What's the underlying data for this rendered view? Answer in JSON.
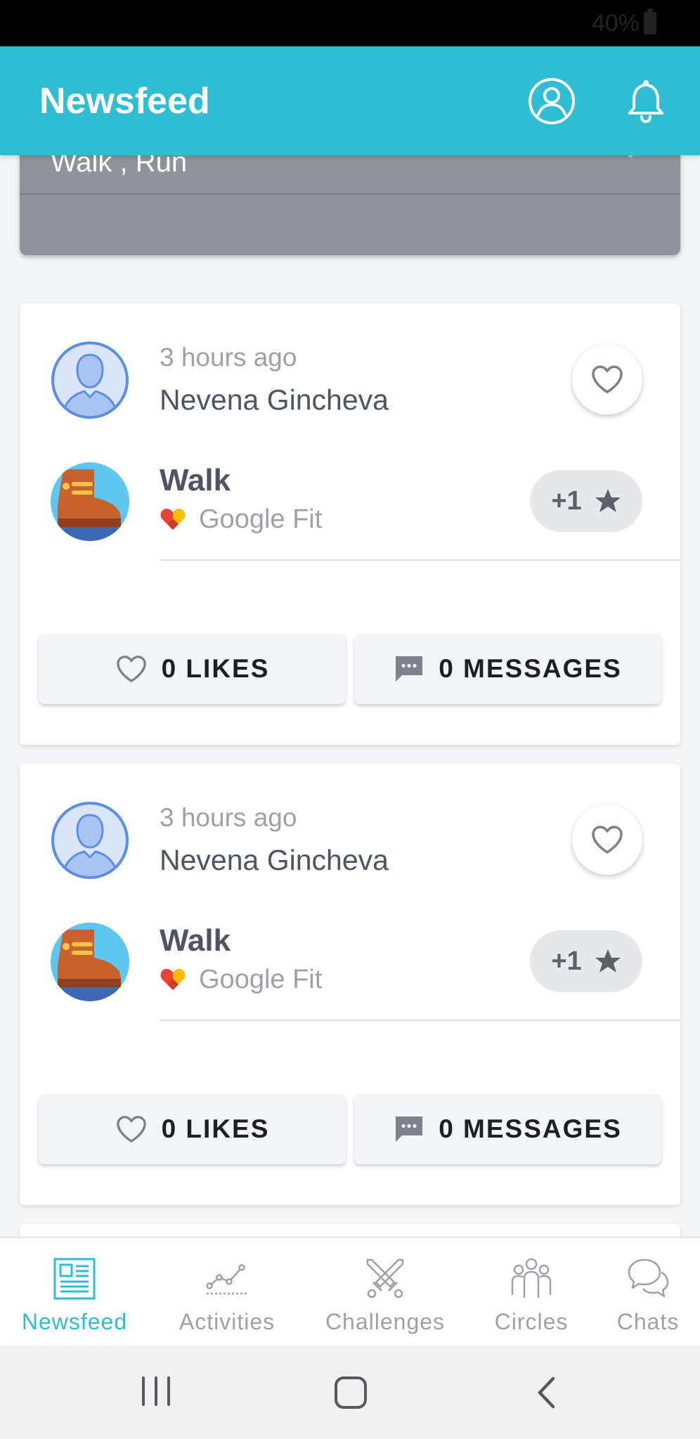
{
  "status_bar": {
    "battery": "40%"
  },
  "header": {
    "title": "Newsfeed"
  },
  "filter": {
    "value": "Walk , Run"
  },
  "posts": [
    {
      "time": "3 hours ago",
      "user": "Nevena Gincheva",
      "activity": "Walk",
      "source": "Google Fit",
      "points": "+1",
      "likes_label": "0 LIKES",
      "messages_label": "0 MESSAGES"
    },
    {
      "time": "3 hours ago",
      "user": "Nevena Gincheva",
      "activity": "Walk",
      "source": "Google Fit",
      "points": "+1",
      "likes_label": "0 LIKES",
      "messages_label": "0 MESSAGES"
    }
  ],
  "bottom_nav": {
    "items": [
      {
        "label": "Newsfeed",
        "icon": "newspaper-icon",
        "active": true
      },
      {
        "label": "Activities",
        "icon": "activity-chart-icon",
        "active": false
      },
      {
        "label": "Challenges",
        "icon": "crossed-swords-icon",
        "active": false
      },
      {
        "label": "Circles",
        "icon": "group-icon",
        "active": false
      },
      {
        "label": "Chats",
        "icon": "chat-bubbles-icon",
        "active": false
      }
    ]
  },
  "colors": {
    "accent": "#2ebdd3",
    "filter_bg": "#909399",
    "page_bg": "#f3f4f6",
    "inactive": "#9ea2a8"
  }
}
